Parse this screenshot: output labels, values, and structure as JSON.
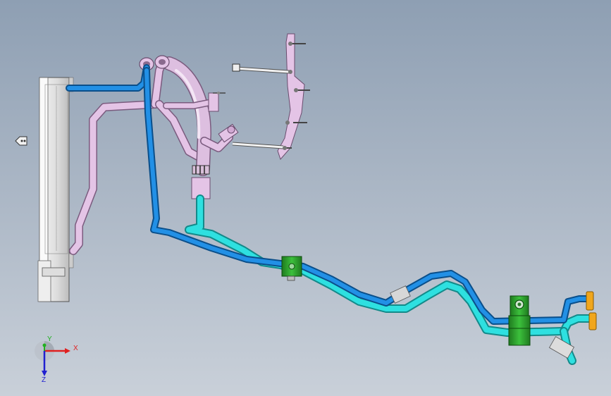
{
  "viewport": {
    "background_top": "#8e9fb3",
    "background_bottom": "#c9d0d9"
  },
  "colors": {
    "tube_blue": "#1e8ee0",
    "tube_cyan": "#27d8d8",
    "tube_pink": "#d9b6dc",
    "bracket_green": "#2ea32e",
    "connector_orange": "#e8a21a",
    "radiator_body": "#eeeeee"
  },
  "model": {
    "parts": [
      "radiator",
      "radiator-connector",
      "pink-hose-assembly",
      "pink-mounting-bracket",
      "blue-coolant-line",
      "cyan-coolant-line",
      "green-clip-small",
      "green-clip-large",
      "orange-end-connectors"
    ]
  },
  "triad": {
    "x_label": "X",
    "y_label": "Y",
    "z_label": "Z",
    "x_color": "#e02020",
    "y_color": "#20b020",
    "z_color": "#2020d0"
  }
}
